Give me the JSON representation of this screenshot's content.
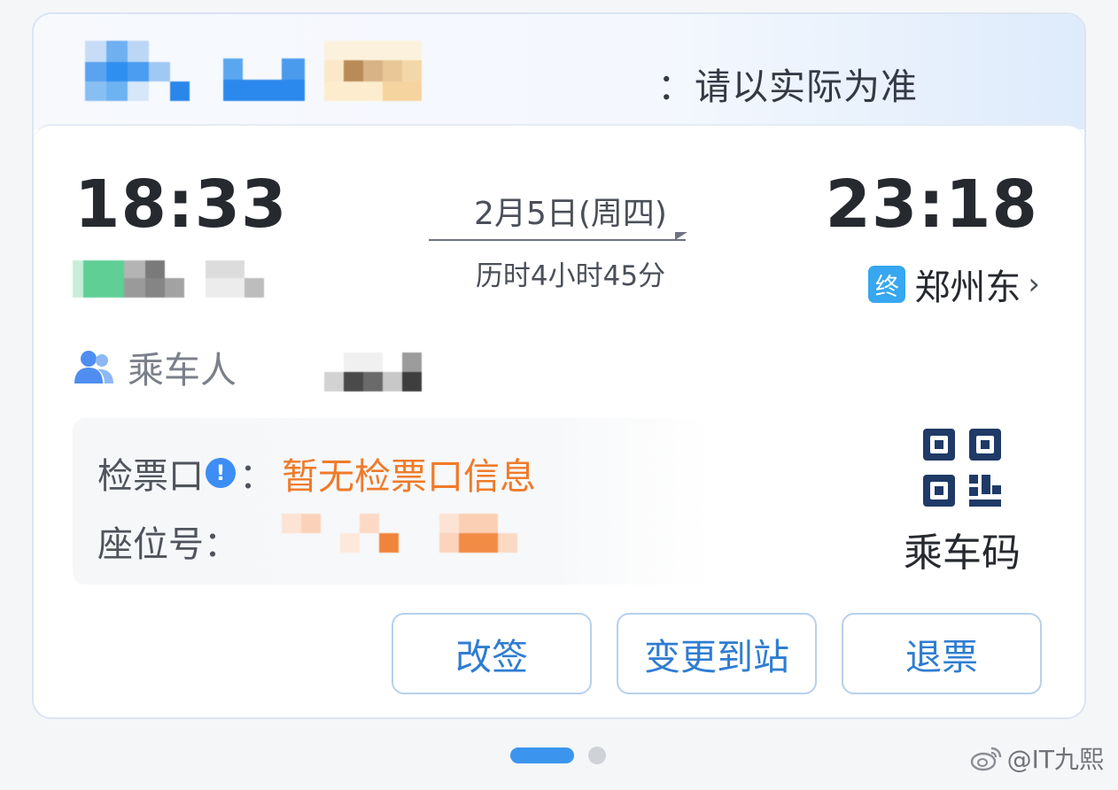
{
  "banner": {
    "notice_text": "请以实际为准",
    "notice_prefix_fragment": "："
  },
  "trip": {
    "depart_time": "18:33",
    "arrive_time": "23:18",
    "date": "2月5日(周四)",
    "duration": "历时4小时45分",
    "end_badge": "终",
    "end_station": "郑州东",
    "end_chevron": "›"
  },
  "passenger": {
    "label": "乘车人"
  },
  "info": {
    "checkin_label": "检票口",
    "checkin_icon": "!",
    "checkin_colon": "：",
    "checkin_value": "暂无检票口信息",
    "seat_label": "座位号："
  },
  "qr": {
    "label": "乘车码",
    "icon": "qr-code-icon"
  },
  "actions": {
    "rebook": "改签",
    "change_destination": "变更到站",
    "refund": "退票"
  },
  "pager": {
    "count": 2,
    "active_index": 0
  },
  "watermark": {
    "text": "@IT九熙"
  },
  "colors": {
    "accent_blue": "#2f7dd1",
    "badge_blue": "#36a7f0",
    "orange": "#ef7b2a",
    "text_dark": "#26292e"
  }
}
